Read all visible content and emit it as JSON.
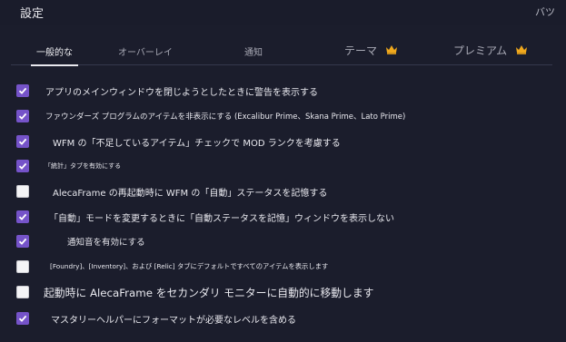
{
  "window": {
    "title": "設定",
    "close_label": "バツ"
  },
  "tabs": [
    {
      "label": "一般的な",
      "active": true
    },
    {
      "label": "オーバーレイ",
      "active": false
    },
    {
      "label": "通知",
      "active": false
    },
    {
      "label": "テーマ",
      "active": false,
      "crown": true
    },
    {
      "label": "プレミアム",
      "active": false,
      "crown": true
    }
  ],
  "colors": {
    "background": "#1b1d2c",
    "checkbox_checked": "#7553c9",
    "crown": "#f0a81c"
  },
  "settings": [
    {
      "label": "アプリのメインウィンドウを閉じようとしたときに警告を表示する",
      "checked": true
    },
    {
      "label": "ファウンダーズ プログラムのアイテムを非表示にする (Excalibur Prime、Skana Prime、Lato Prime)",
      "checked": true
    },
    {
      "label": "WFM の「不足しているアイテム」チェックで MOD ランクを考慮する",
      "checked": true
    },
    {
      "label": "「統計」タブを有効にする",
      "checked": true
    },
    {
      "label": "AlecaFrame の再起動時に WFM の「自動」ステータスを記憶する",
      "checked": false
    },
    {
      "label": "「自動」モードを変更するときに「自動ステータスを記憶」ウィンドウを表示しない",
      "checked": true
    },
    {
      "label": "通知音を有効にする",
      "checked": true
    },
    {
      "label": "[Foundry]、[Inventory]、および [Relic] タブにデフォルトですべてのアイテムを表示します",
      "checked": false
    },
    {
      "label": "起動時に AlecaFrame をセカンダリ モニターに自動的に移動します",
      "checked": false
    },
    {
      "label": "マスタリーヘルパーにフォーマットが必要なレベルを含める",
      "checked": true
    }
  ]
}
